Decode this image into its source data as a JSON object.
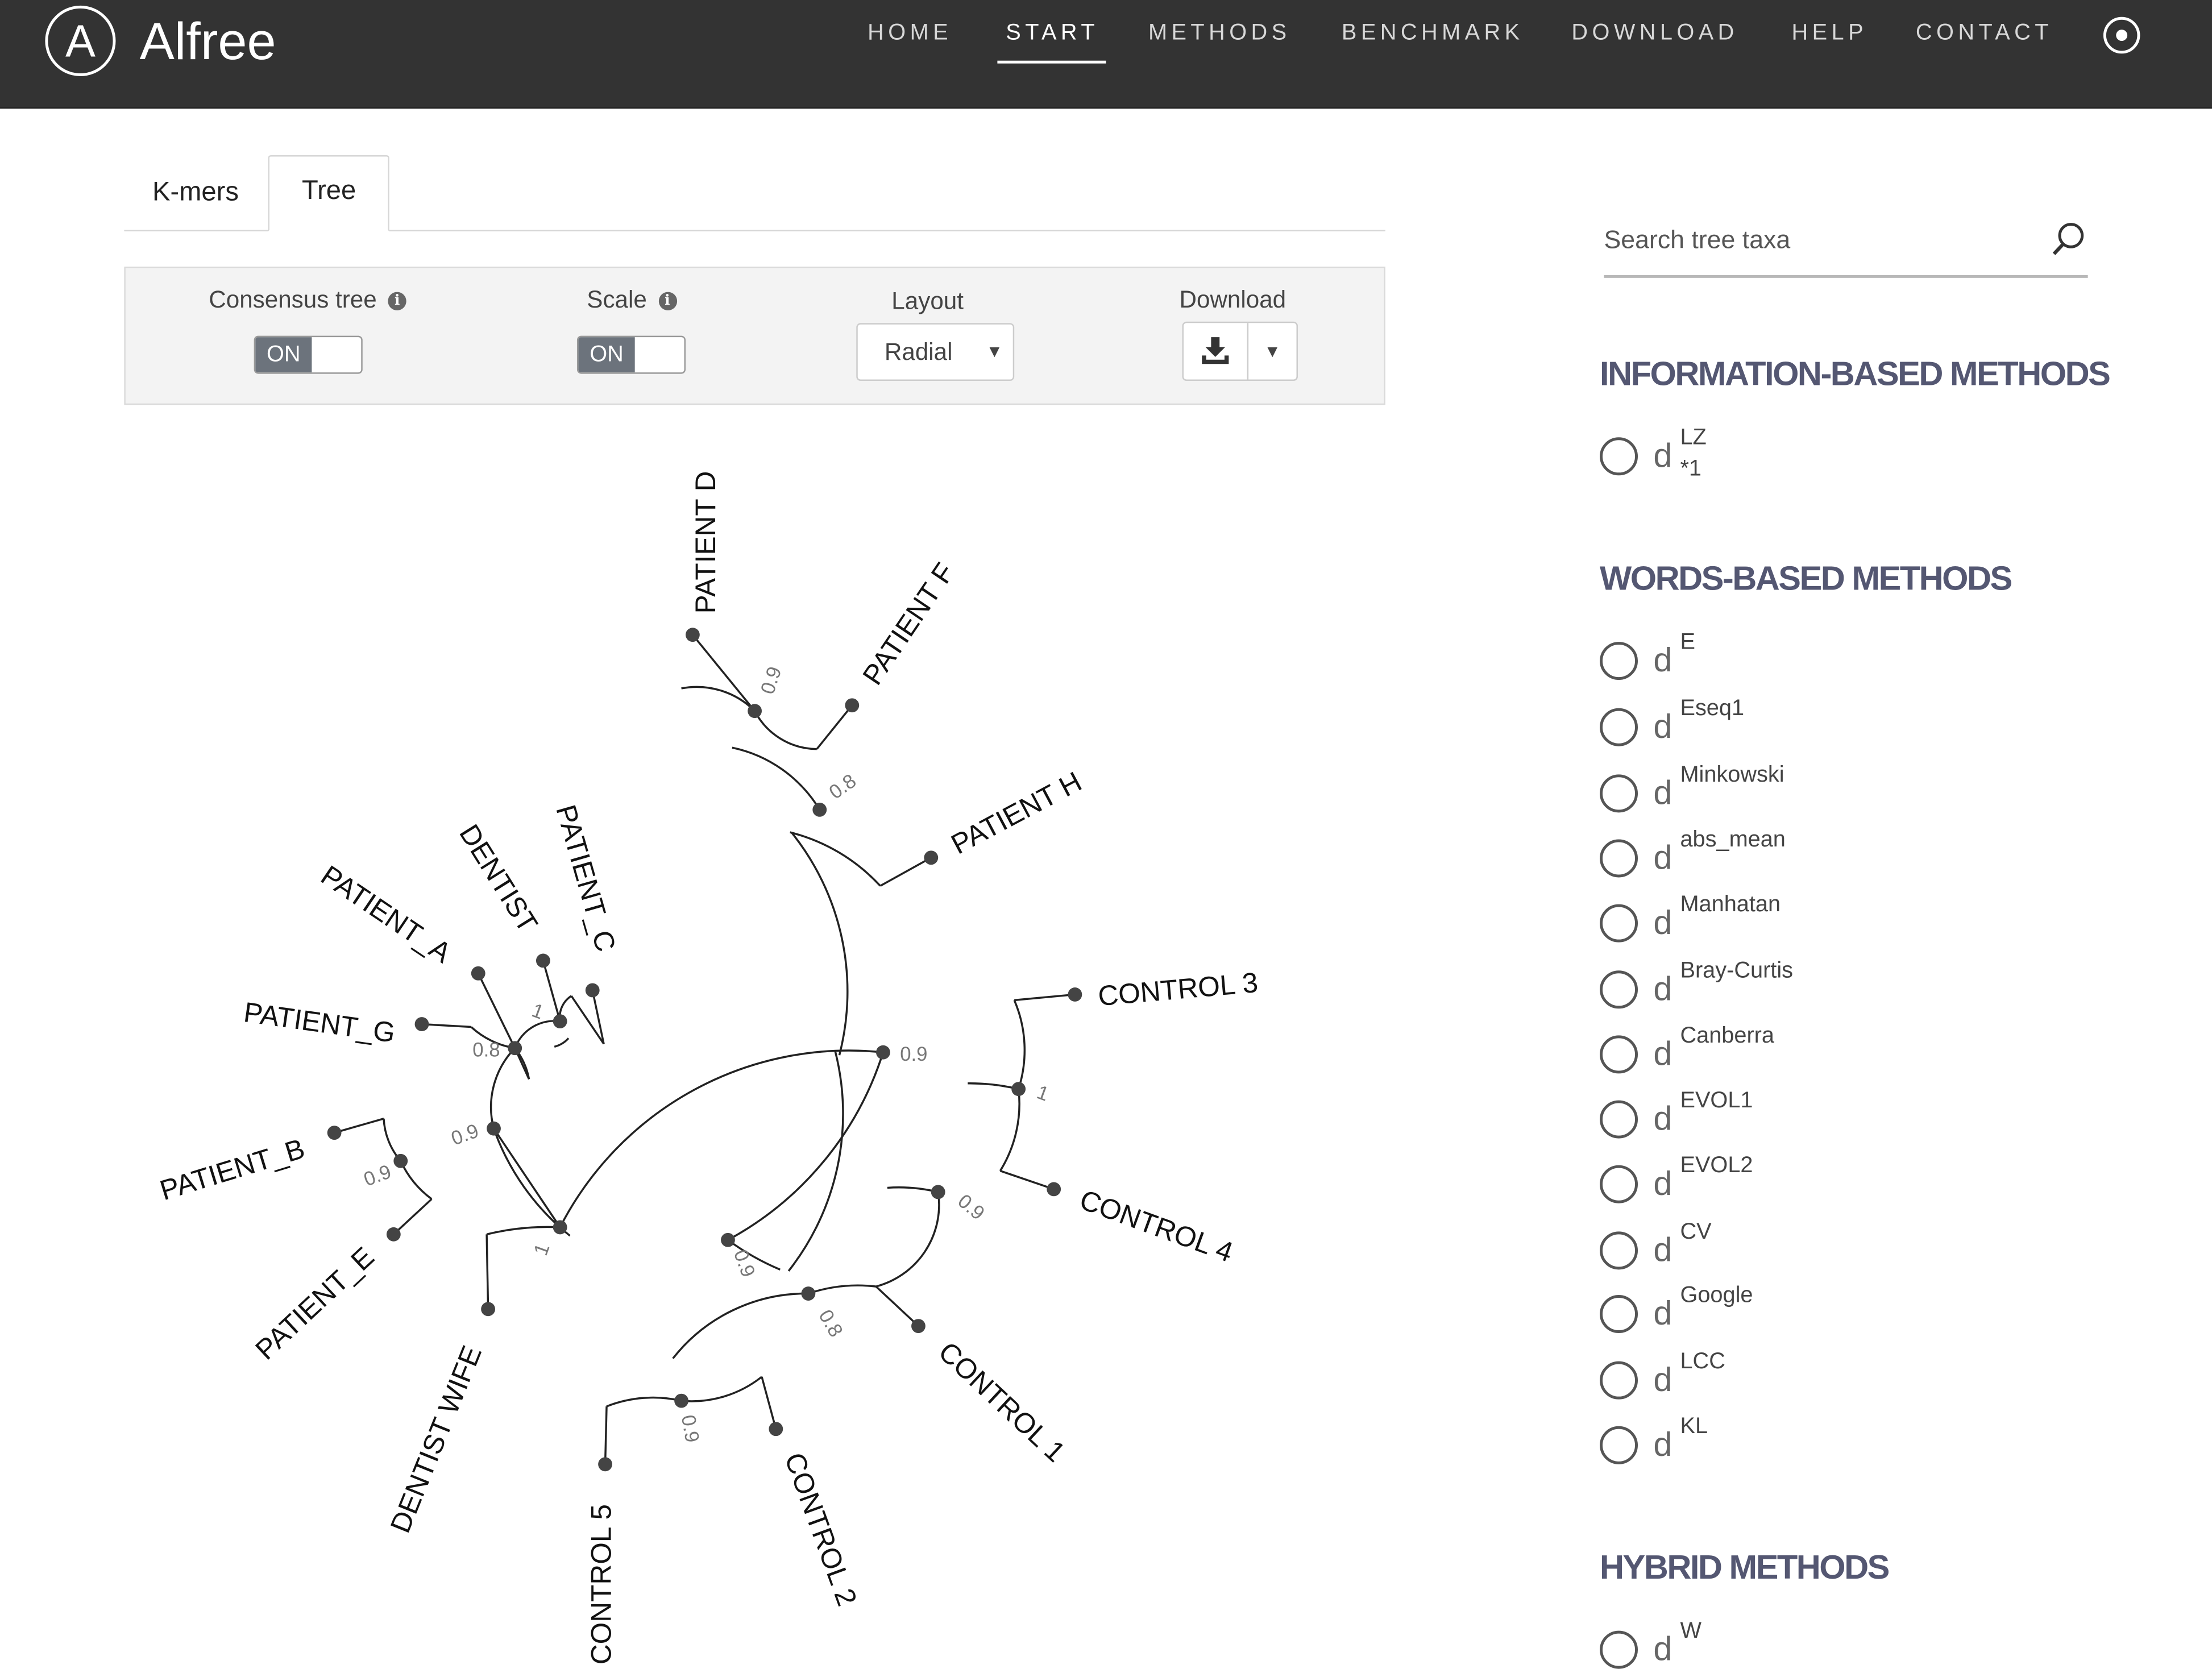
{
  "app": {
    "logo_letter": "A",
    "brand": "Alfree"
  },
  "nav": {
    "items": [
      "HOME",
      "START",
      "METHODS",
      "BENCHMARK",
      "DOWNLOAD",
      "HELP",
      "CONTACT"
    ],
    "active": "START"
  },
  "tabs": [
    "K-mers",
    "Tree"
  ],
  "active_tab": "Tree",
  "controls": {
    "consensus_label": "Consensus tree",
    "consensus_state": "ON",
    "scale_label": "Scale",
    "scale_state": "ON",
    "layout_label": "Layout",
    "layout_value": "Radial",
    "download_label": "Download"
  },
  "tree": {
    "layout": "radial",
    "leaves": [
      "PATIENT D",
      "PATIENT F",
      "PATIENT H",
      "CONTROL 3",
      "CONTROL 4",
      "CONTROL 1",
      "CONTROL 2",
      "CONTROL 5",
      "DENTIST WIFE",
      "PATIENT_E",
      "PATIENT_B",
      "PATIENT_G",
      "PATIENT_A",
      "DENTIST",
      "PATIENT_C"
    ],
    "support_values": [
      "0.9",
      "0.8",
      "0.9",
      "1",
      "0.9",
      "0.8",
      "0.9",
      "0.9",
      "1",
      "0.9",
      "0.9",
      "0.8",
      "1"
    ]
  },
  "sidebar": {
    "search_placeholder": "Search tree taxa",
    "sections": [
      {
        "title": "INFORMATION-BASED METHODS",
        "methods": [
          {
            "symbol": "d",
            "sup": "LZ",
            "sub": "*1"
          }
        ]
      },
      {
        "title": "WORDS-BASED METHODS",
        "methods": [
          {
            "symbol": "d",
            "sup": "E"
          },
          {
            "symbol": "d",
            "sup": "Eseq1"
          },
          {
            "symbol": "d",
            "sup": "Minkowski"
          },
          {
            "symbol": "d",
            "sup": "abs_mean"
          },
          {
            "symbol": "d",
            "sup": "Manhatan"
          },
          {
            "symbol": "d",
            "sup": "Bray-Curtis"
          },
          {
            "symbol": "d",
            "sup": "Canberra"
          },
          {
            "symbol": "d",
            "sup": "EVOL1"
          },
          {
            "symbol": "d",
            "sup": "EVOL2"
          },
          {
            "symbol": "d",
            "sup": "CV"
          },
          {
            "symbol": "d",
            "sup": "Google"
          },
          {
            "symbol": "d",
            "sup": "LCC"
          },
          {
            "symbol": "d",
            "sup": "KL"
          }
        ]
      },
      {
        "title": "HYBRID METHODS",
        "methods": [
          {
            "symbol": "d",
            "sup": "W"
          }
        ]
      }
    ]
  },
  "colors": {
    "topbar": "#333333",
    "section_title": "#545772",
    "toggle_on": "#6c737c",
    "tree_line": "#222222",
    "node": "#444444",
    "support_label": "#777777"
  }
}
